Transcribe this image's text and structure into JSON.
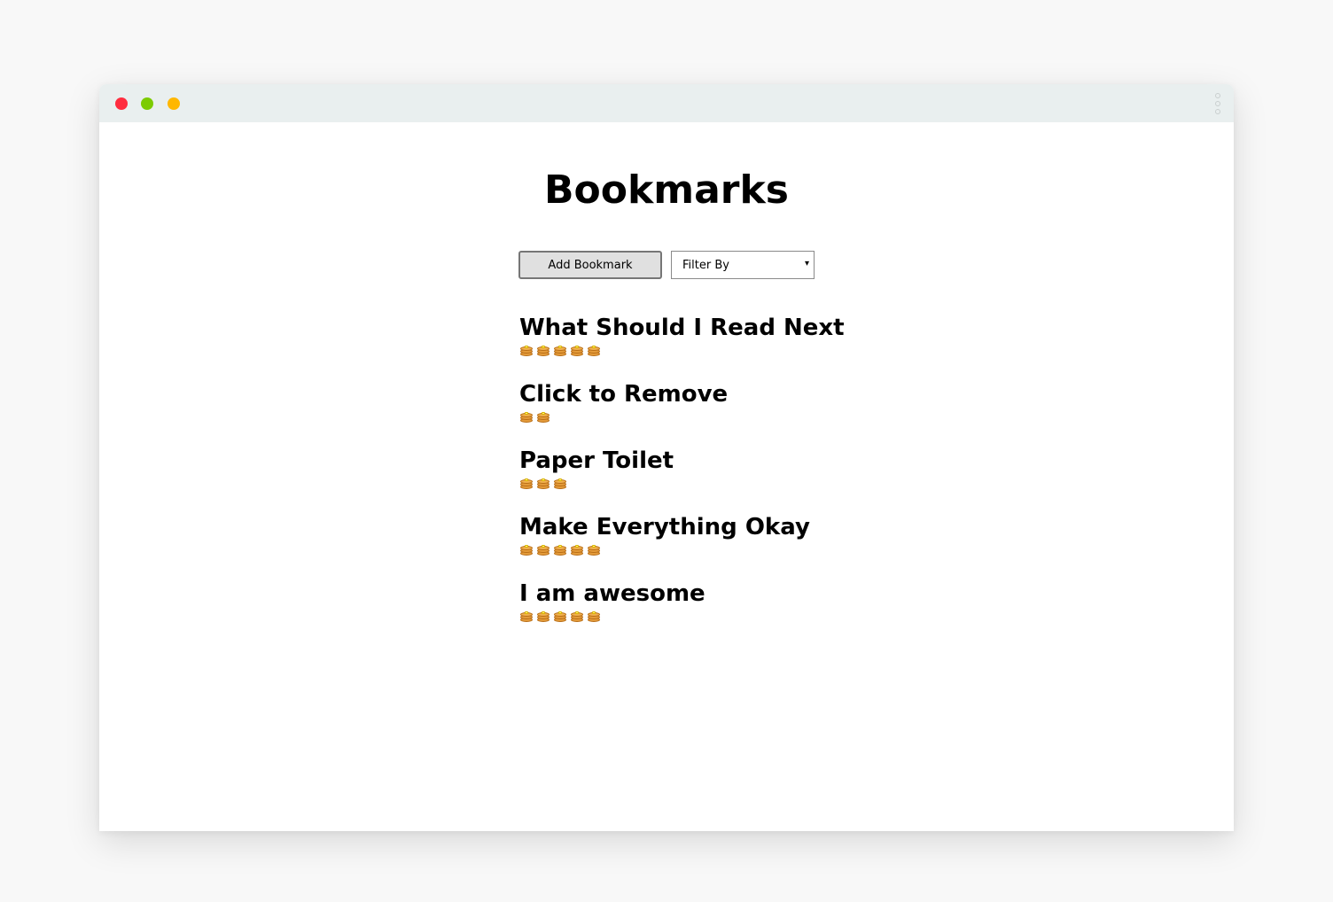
{
  "window": {
    "controls": [
      "close",
      "maximize",
      "minimize"
    ],
    "menu_icon": "kebab-menu-icon"
  },
  "page": {
    "title": "Bookmarks"
  },
  "toolbar": {
    "add_label": "Add Bookmark",
    "filter_label": "Filter By",
    "filter_caret": "▾"
  },
  "rating_icon": "pancake-icon",
  "bookmarks": [
    {
      "title": "What Should I Read Next",
      "rating": 5
    },
    {
      "title": "Click to Remove",
      "rating": 2
    },
    {
      "title": "Paper Toilet",
      "rating": 3
    },
    {
      "title": "Make Everything Okay",
      "rating": 5
    },
    {
      "title": "I am awesome",
      "rating": 5
    }
  ],
  "colors": {
    "close": "#ff2d3f",
    "maximize": "#7ccb00",
    "minimize": "#ffb700",
    "titlebar": "#e9efef",
    "background": "#f8f8f8"
  }
}
